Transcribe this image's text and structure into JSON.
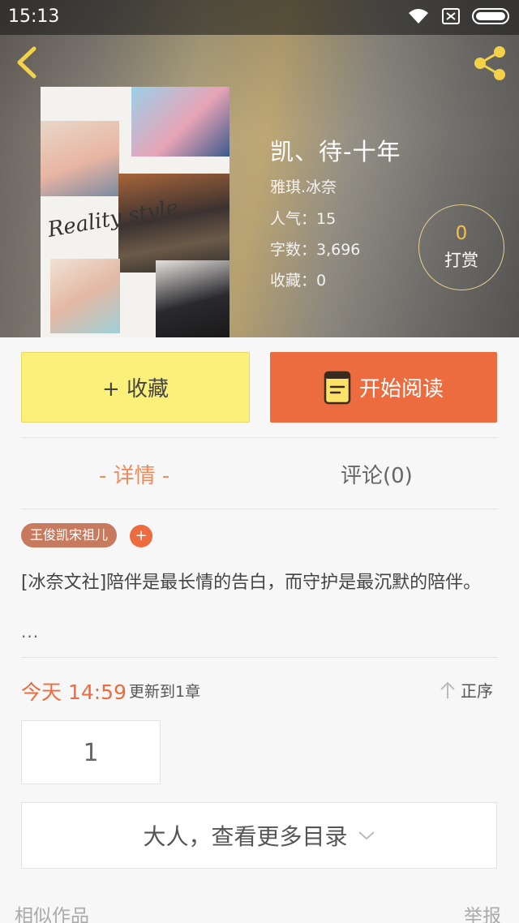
{
  "status_bar": {
    "time": "15:13"
  },
  "book": {
    "title": "凯、待-十年",
    "author": "雅琪.冰奈",
    "popularity": "人气：15",
    "word_count": "字数：3,696",
    "favorites": "收藏：0",
    "cover_script": "Reality style"
  },
  "reward": {
    "count": "0",
    "label": "打赏"
  },
  "actions": {
    "collect_label": "+ 收藏",
    "read_label": "开始阅读"
  },
  "tabs": [
    {
      "label": "- 详情 -",
      "active": true
    },
    {
      "label": "评论(0)",
      "active": false
    }
  ],
  "tag": {
    "label": "王俊凯宋祖儿",
    "add_symbol": "+"
  },
  "synopsis": {
    "text": "[冰奈文社]陪伴是最长情的告白，而守护是最沉默的陪伴。",
    "more": "..."
  },
  "update": {
    "time": "今天 14:59",
    "text": "更新到1章",
    "sort_label": "正序"
  },
  "chapters": [
    "1"
  ],
  "more_catalog_label": "大人，查看更多目录",
  "footer": {
    "similar_label": "相似作品",
    "report_label": "举报"
  },
  "colors": {
    "accent": "#ec6b3f",
    "collect_bg": "#fbf07a",
    "tag_bg": "#c87a5f",
    "reward_text": "#f4c04f",
    "tab_active": "#ef8a5b"
  },
  "icons": [
    "wifi-icon",
    "sim-icon",
    "battery-icon",
    "back-arrow-icon",
    "share-icon",
    "book-icon",
    "sort-up-arrow-icon",
    "chevron-down-icon"
  ]
}
